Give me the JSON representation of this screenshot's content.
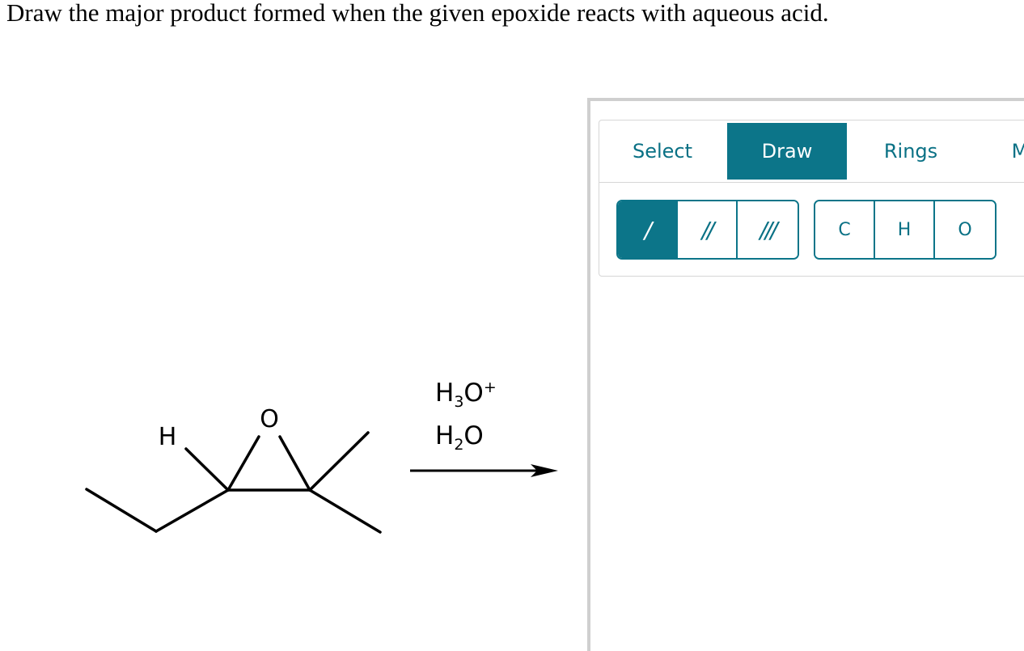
{
  "question": "Draw the major product formed when the given epoxide reacts with aqueous acid.",
  "reactant": {
    "atoms": [
      "H",
      "O"
    ]
  },
  "reagents": {
    "line1": {
      "base": "H",
      "sub": "3",
      "atom": "O",
      "sup": "+"
    },
    "line2": {
      "base": "H",
      "sub": "2",
      "atom": "O"
    }
  },
  "toolbar": {
    "tabs": [
      {
        "label": "Select",
        "active": false
      },
      {
        "label": "Draw",
        "active": true
      },
      {
        "label": "Rings",
        "active": false
      },
      {
        "label": "M",
        "active": false
      }
    ],
    "bonds": [
      {
        "name": "single-bond",
        "glyph": "/",
        "active": true
      },
      {
        "name": "double-bond",
        "glyph": "//",
        "active": false
      },
      {
        "name": "triple-bond",
        "glyph": "///",
        "active": false
      }
    ],
    "atoms": [
      "C",
      "H",
      "O"
    ]
  },
  "colors": {
    "accent": "#0c7589",
    "accent_text": "#0a7185",
    "border": "#d6d6d6",
    "frame": "#cfcfcf"
  }
}
